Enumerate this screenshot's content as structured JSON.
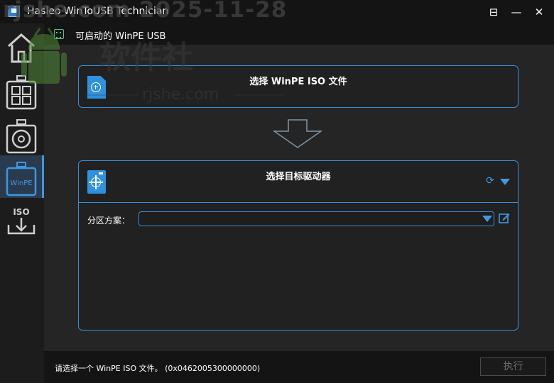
{
  "window": {
    "title": "Hasleo WinToUSB Technician",
    "minimize_glyph": "⊟",
    "maximize_glyph": "—",
    "close_glyph": "✕"
  },
  "sidebar": {
    "items": [
      {
        "id": "home",
        "icon": "home-icon"
      },
      {
        "id": "windows-to-go",
        "icon": "windows-usb-icon"
      },
      {
        "id": "disk-clone",
        "icon": "disk-usb-icon"
      },
      {
        "id": "winpe",
        "icon": "winpe-usb-icon",
        "label": "WinPE",
        "active": true
      },
      {
        "id": "iso",
        "icon": "iso-download-icon",
        "label": "ISO"
      }
    ]
  },
  "breadcrumb": {
    "icon": "bootable-usb-icon",
    "text": "可启动的 WinPE USB"
  },
  "iso_panel": {
    "title": "选择 WinPE ISO 文件",
    "icon": "add-file-icon"
  },
  "drive_panel": {
    "title": "选择目标驱动器",
    "icon": "target-drive-icon",
    "partition_scheme_label": "分区方案：",
    "partition_scheme_value": ""
  },
  "statusbar": {
    "message": "请选择一个 WinPE ISO 文件。 (0x0462005300000000)",
    "execute_label": "执行"
  },
  "watermark": {
    "text": "rjshe.com 2025-11-28",
    "site": "软件社",
    "domain": "rjshe.com"
  },
  "colors": {
    "accent": "#3a8fd8",
    "background": "#252525",
    "titlebar": "#141414",
    "sidebar": "#1c1c1c",
    "active_item": "#2a3b4f",
    "icon_green": "#51c28b"
  }
}
